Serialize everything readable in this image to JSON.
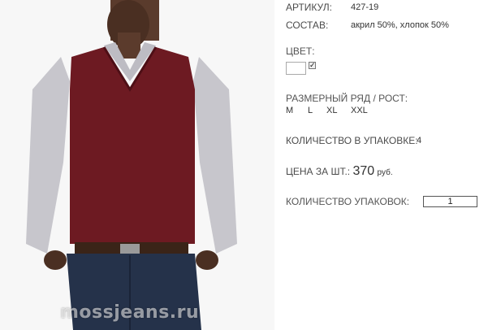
{
  "product_image": {
    "watermark": "mossjeans.ru"
  },
  "details": {
    "article_label": "АРТИКУЛ:",
    "article_value": "427-19",
    "composition_label": "СОСТАВ:",
    "composition_value": "акрил 50%, хлопок 50%",
    "color_label": "ЦВЕТ:",
    "color_selected": "#ffffff",
    "size_label": "РАЗМЕРНЫЙ РЯД / РОСТ:",
    "sizes": [
      "M",
      "L",
      "XL",
      "XXL"
    ],
    "pack_qty_label": "КОЛИЧЕСТВО В УПАКОВКЕ:",
    "pack_qty_value": "4",
    "price_label": "ЦЕНА ЗА ШТ.:",
    "price_value": "370",
    "price_unit": "руб.",
    "packs_label": "КОЛИЧЕСТВО УПАКОВОК:",
    "packs_value": "1"
  }
}
